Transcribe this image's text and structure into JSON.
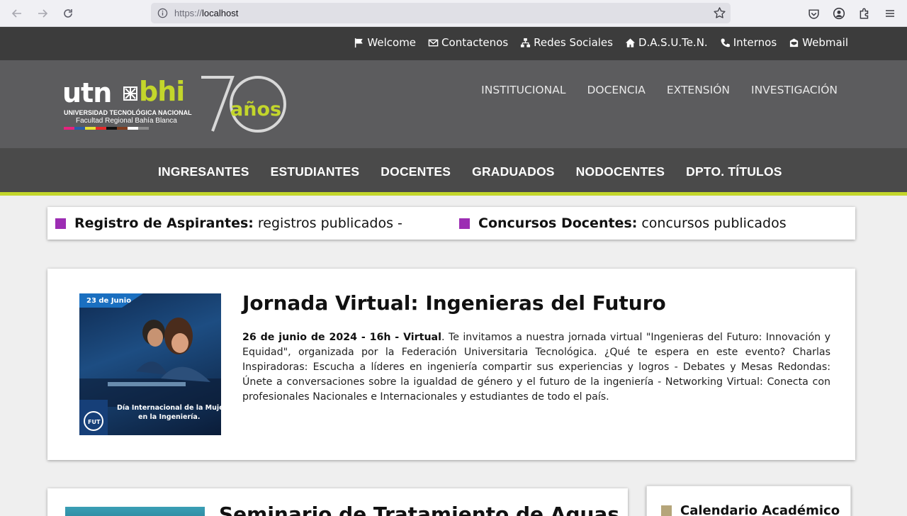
{
  "browser": {
    "url_protocol": "https://",
    "url_host": "localhost"
  },
  "toplinks": [
    {
      "label": "Welcome",
      "icon": "flag-icon"
    },
    {
      "label": "Contactenos",
      "icon": "envelope-icon"
    },
    {
      "label": "Redes Sociales",
      "icon": "network-icon"
    },
    {
      "label": "D.A.S.U.Te.N.",
      "icon": "home-icon"
    },
    {
      "label": "Internos",
      "icon": "phone-icon"
    },
    {
      "label": "Webmail",
      "icon": "mail-box-icon"
    }
  ],
  "logo": {
    "utn": "utn",
    "bhi": "bhi",
    "sub1": "UNIVERSIDAD TECNOLÓGICA NACIONAL",
    "sub2": "Facultad Regional Bahía Blanca",
    "anniversary_number": "70",
    "anniversary_word": "años",
    "accent_color": "#c3d62b"
  },
  "main_nav": [
    "INSTITUCIONAL",
    "DOCENCIA",
    "EXTENSIÓN",
    "INVESTIGACIÓN"
  ],
  "sec_nav": [
    "INGRESANTES",
    "ESTUDIANTES",
    "DOCENTES",
    "GRADUADOS",
    "NODOCENTES",
    "DPTO. TÍTULOS"
  ],
  "notices": [
    {
      "title": "Registro de Aspirantes:",
      "text": "registros publicados -"
    },
    {
      "title": "Concursos Docentes:",
      "text": "concursos publicados"
    }
  ],
  "notice_color": "#9c2db3",
  "feature": {
    "title": "Jornada Virtual: Ingenieras del Futuro",
    "date_bold": "26 de junio de 2024 - 16h - Virtual",
    "body": ". Te invitamos a nuestra jornada virtual \"Ingenieras del Futuro: Innovación y Equidad\", organizada por la Federación Universitaria Tecnológica. ¿Qué te espera en este evento? Charlas Inspiradoras: Escucha a líderes en ingeniería compartir sus experiencias y logros - Debates y Mesas Redondas: Únete a conversaciones sobre la igualdad de género y el futuro de la ingeniería - Networking Virtual: Conecta con profesionales Nacionales e Internacionales y estudiantes de todo el país.",
    "image": {
      "tag": "23 de Junio",
      "caption_line1": "Día Internacional de la Mujer",
      "caption_line2": "en la Ingeniería.",
      "badge": "FUT"
    }
  },
  "second": {
    "title": "Seminario de Tratamiento de Aguas"
  },
  "sidebar": {
    "title": "Calendario Académico"
  }
}
